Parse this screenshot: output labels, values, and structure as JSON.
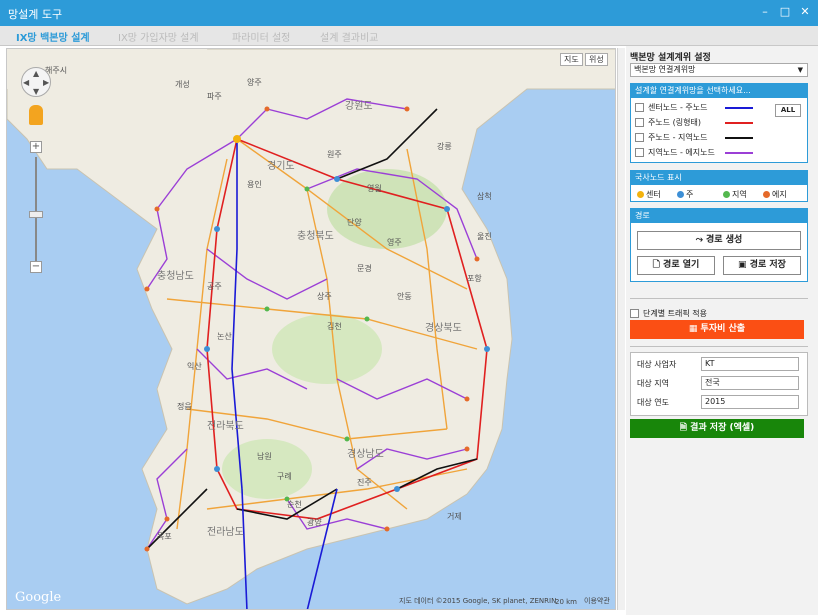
{
  "window": {
    "title": "망설계 도구",
    "minimize": "–",
    "maximize": "□",
    "close": "✕"
  },
  "tabs": [
    {
      "label": "IX망 백본망 설계",
      "active": true
    },
    {
      "label": "IX망 가입자망 설계",
      "active": false
    },
    {
      "label": "파라미터 설정",
      "active": false
    },
    {
      "label": "설계 결과비교",
      "active": false
    }
  ],
  "map": {
    "toggle_map": "지도",
    "toggle_satellite": "위성",
    "zoom_in": "+",
    "zoom_out": "−",
    "google_logo": "Google",
    "attribution": "지도 데이터 ©2015 Google, SK planet, ZENRIN",
    "scale": "20 km",
    "terms": "이용약관",
    "place_labels": [
      "해주시",
      "개성",
      "파주",
      "양주",
      "강원도",
      "원주",
      "경기도",
      "용인",
      "영월",
      "단양",
      "충청북도",
      "문경",
      "김천",
      "경상북도",
      "포항",
      "충청남도",
      "공주",
      "논산",
      "익산",
      "정읍",
      "전라북도",
      "남원",
      "구례",
      "순천",
      "광양",
      "전라남도",
      "목포",
      "경상남도",
      "진주",
      "거제",
      "상주",
      "안동",
      "강릉",
      "삼척",
      "울진",
      "영주"
    ]
  },
  "panel": {
    "design_unit_label": "백본망 설계계위 설정",
    "design_unit_value": "백본망 연결계위망",
    "design_unit_arrow": "▼",
    "link_section_header": "설계할 연결계위망을 선택하세요...",
    "all_button": "ALL",
    "link_types": [
      {
        "label": "센터노드 - 주노드",
        "color": "#1a1ad6"
      },
      {
        "label": "주노드 (링형태)",
        "color": "#e02020"
      },
      {
        "label": "주노드 - 지역노드",
        "color": "#111111"
      },
      {
        "label": "지역노드 - 에지노드",
        "color": "#9b3fd6"
      }
    ],
    "node_section_header": "국사노드 표시",
    "node_types": [
      {
        "label": "센터",
        "color": "#f3b20e"
      },
      {
        "label": "주",
        "color": "#3d8fd6"
      },
      {
        "label": "지역",
        "color": "#54b84e"
      },
      {
        "label": "에지",
        "color": "#e56a2a"
      }
    ],
    "route_section_header": "경로",
    "route_create": "경로 생성",
    "route_open": "경로 열기",
    "route_save": "경로 저장",
    "traffic_check": "단계별 트래픽 적용",
    "invest_button": "투자비 산출",
    "info": [
      {
        "label": "대상 사업자",
        "value": "KT"
      },
      {
        "label": "대상 지역",
        "value": "전국"
      },
      {
        "label": "대상 연도",
        "value": "2015"
      }
    ],
    "excel_button": "결과 저장 (엑셀)"
  }
}
